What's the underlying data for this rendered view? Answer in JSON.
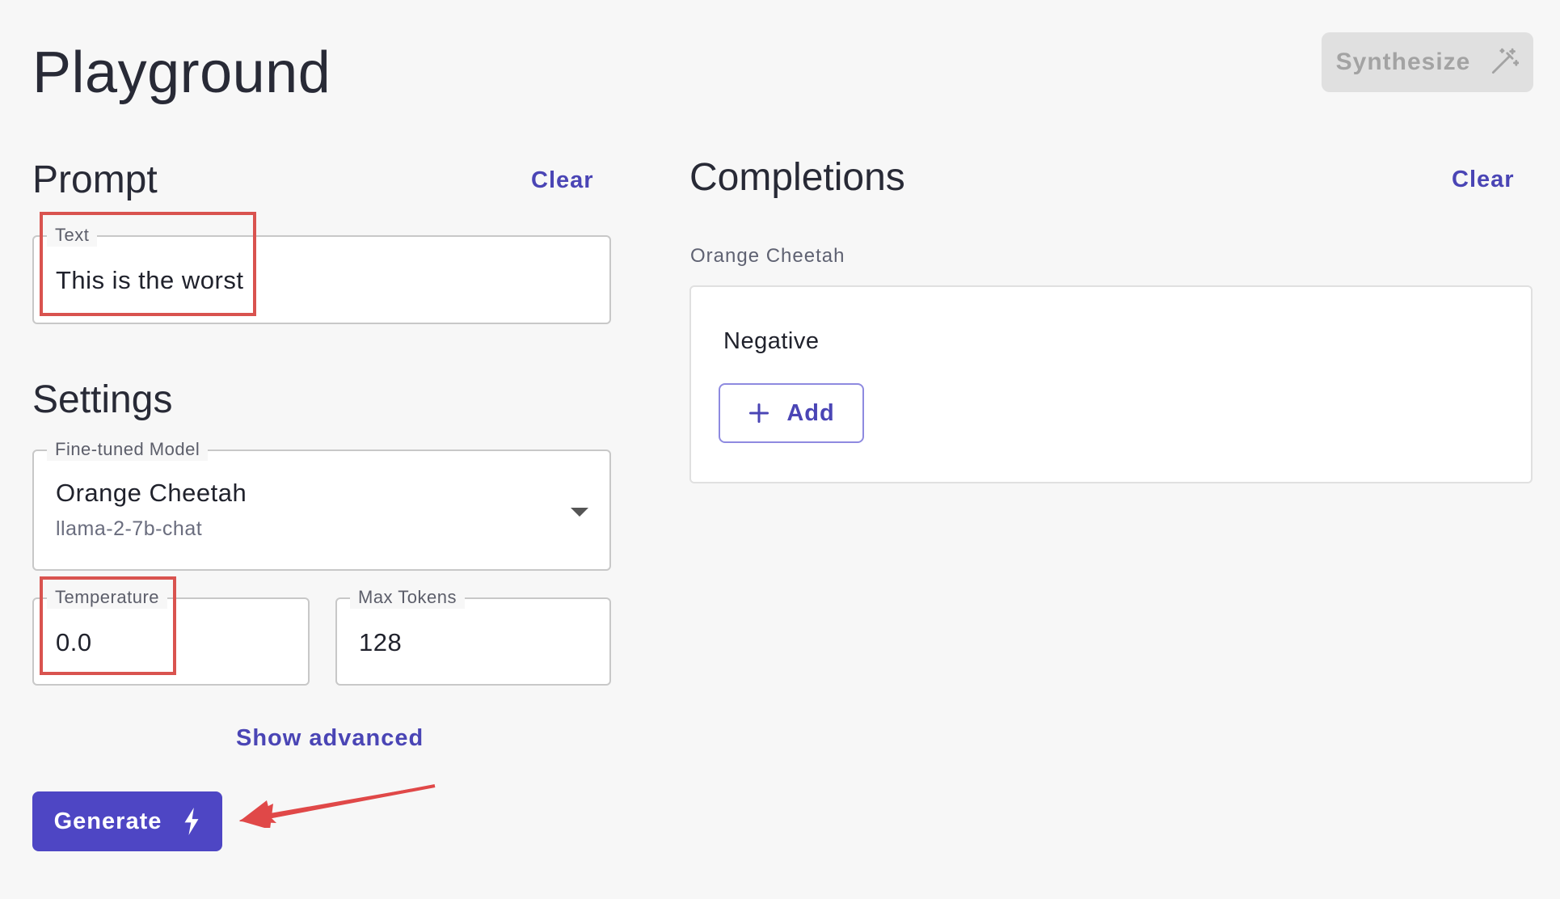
{
  "header": {
    "title": "Playground",
    "synthesize_label": "Synthesize"
  },
  "prompt": {
    "title": "Prompt",
    "clear_label": "Clear",
    "text_field": {
      "label": "Text",
      "value": "This is the worst"
    }
  },
  "settings": {
    "title": "Settings",
    "model_field": {
      "label": "Fine-tuned Model",
      "value": "Orange Cheetah",
      "sub_value": "llama-2-7b-chat"
    },
    "temperature_field": {
      "label": "Temperature",
      "value": "0.0"
    },
    "max_tokens_field": {
      "label": "Max Tokens",
      "value": "128"
    },
    "show_advanced_label": "Show advanced",
    "generate_label": "Generate"
  },
  "completions": {
    "title": "Completions",
    "clear_label": "Clear",
    "model_name": "Orange Cheetah",
    "result_text": "Negative",
    "add_label": "Add"
  },
  "colors": {
    "accent": "#4e46c4",
    "highlight": "#d9534f",
    "disabled": "#e0e0e0"
  },
  "icons": {
    "synthesize": "magic-wand-icon",
    "generate": "lightning-icon",
    "add": "plus-icon",
    "dropdown": "caret-down-icon"
  }
}
